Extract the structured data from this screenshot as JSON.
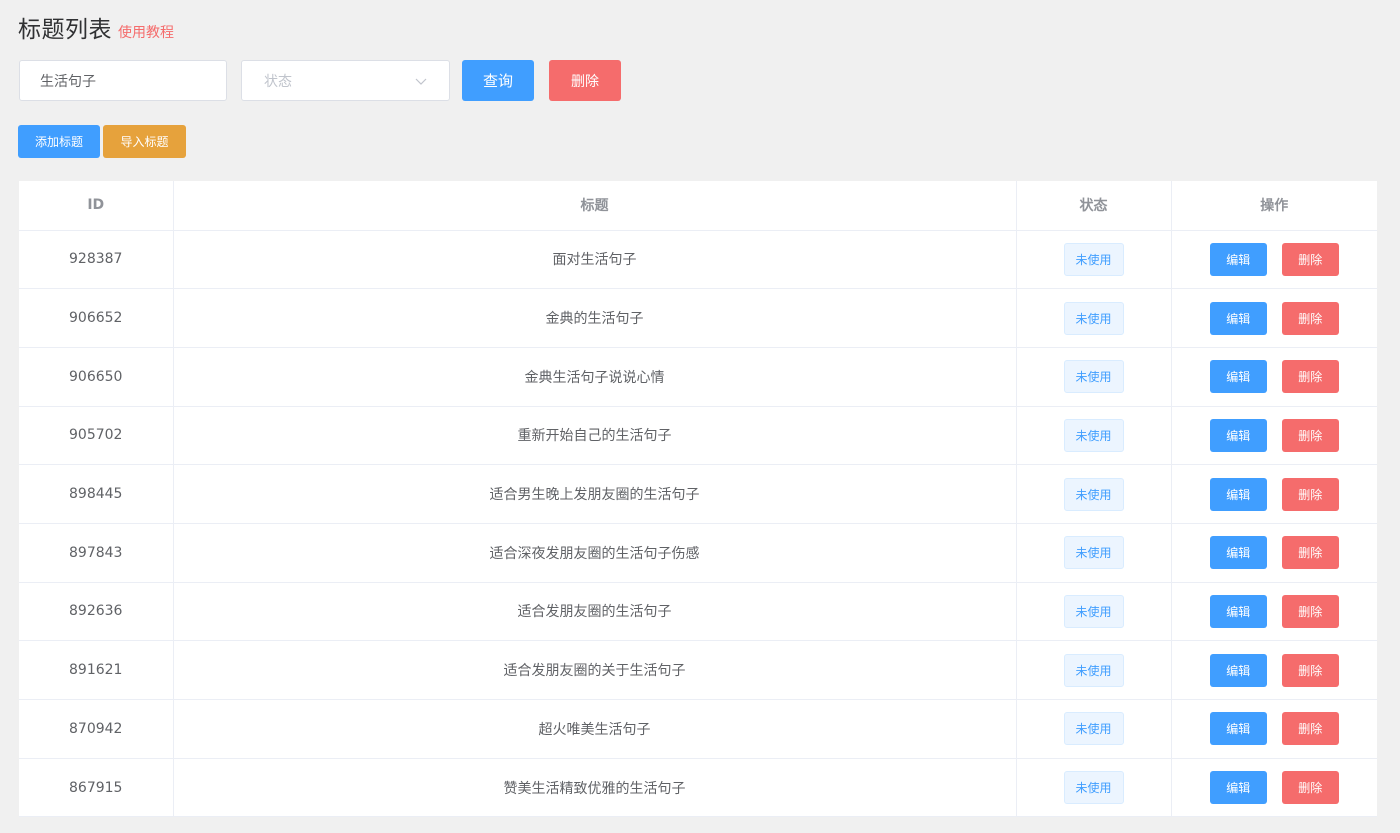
{
  "header": {
    "title": "标题列表",
    "tutorial_link": "使用教程"
  },
  "search": {
    "keyword_value": "生活句子",
    "status_placeholder": "状态",
    "query_label": "查询",
    "delete_label": "删除"
  },
  "actions": {
    "add_label": "添加标题",
    "import_label": "导入标题"
  },
  "table": {
    "columns": [
      "ID",
      "标题",
      "状态",
      "操作"
    ],
    "edit_label": "编辑",
    "delete_label": "删除",
    "rows": [
      {
        "id": "928387",
        "title": "面对生活句子",
        "status": "未使用"
      },
      {
        "id": "906652",
        "title": "金典的生活句子",
        "status": "未使用"
      },
      {
        "id": "906650",
        "title": "金典生活句子说说心情",
        "status": "未使用"
      },
      {
        "id": "905702",
        "title": "重新开始自己的生活句子",
        "status": "未使用"
      },
      {
        "id": "898445",
        "title": "适合男生晚上发朋友圈的生活句子",
        "status": "未使用"
      },
      {
        "id": "897843",
        "title": "适合深夜发朋友圈的生活句子伤感",
        "status": "未使用"
      },
      {
        "id": "892636",
        "title": "适合发朋友圈的生活句子",
        "status": "未使用"
      },
      {
        "id": "891621",
        "title": "适合发朋友圈的关于生活句子",
        "status": "未使用"
      },
      {
        "id": "870942",
        "title": "超火唯美生活句子",
        "status": "未使用"
      },
      {
        "id": "867915",
        "title": "赞美生活精致优雅的生活句子",
        "status": "未使用"
      }
    ]
  },
  "colors": {
    "primary": "#409eff",
    "danger": "#f56c6c",
    "warning": "#e6a23c",
    "background": "#f0f0f0"
  }
}
